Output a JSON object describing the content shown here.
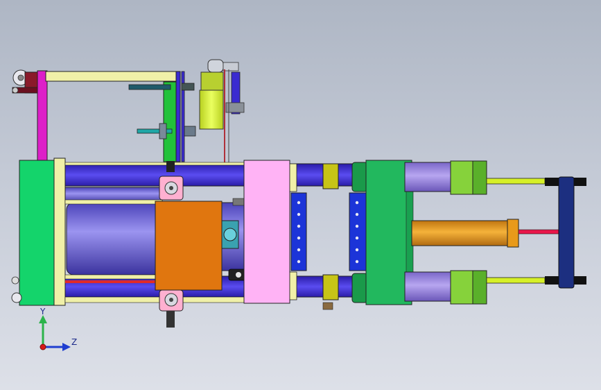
{
  "viewport": {
    "background_top": "#aeb6c4",
    "background_bottom": "#dde0e8"
  },
  "triad": {
    "y_label": "Y",
    "z_label": "Z",
    "y_color": "#2bb34a",
    "z_color": "#1f3ed0",
    "origin_color": "#d61a1a"
  },
  "model": {
    "colors": {
      "base_green": "#14d46b",
      "platen_green": "#22b85e",
      "cream": "#f0f0a8",
      "tie_bar": "#3a2bd0",
      "barrel": "#7a73e6",
      "hopper_block": "#e0760f",
      "moving_platen": "#ffb3f5",
      "mold_blue": "#1c34d8",
      "cylinder_purple": "#9c87e0",
      "nut_green": "#86d23b",
      "rod_yellow": "#d6f028",
      "center_rod": "#e89a1a",
      "ejector_red": "#e8164a",
      "end_plate": "#1c2f80",
      "frame_magenta": "#dd1fc8",
      "motor_yellow": "#d6f03a",
      "clamp_olive": "#c7c417"
    }
  }
}
